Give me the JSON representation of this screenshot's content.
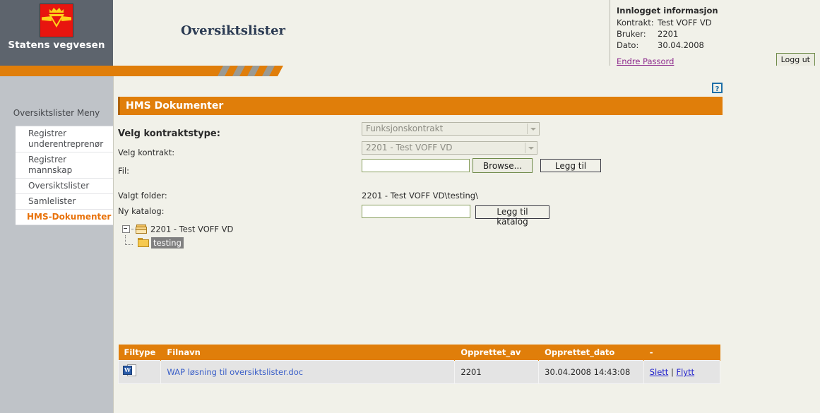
{
  "brand": {
    "name": "Statens vegvesen",
    "logo_icon": "vegvesen-emblem-icon"
  },
  "header": {
    "page_title": "Oversiktslister"
  },
  "login_info": {
    "heading": "Innlogget informasjon",
    "rows": [
      {
        "key": "Kontrakt:",
        "value": "Test VOFF VD"
      },
      {
        "key": "Bruker:",
        "value": "2201"
      },
      {
        "key": "Dato:",
        "value": "30.04.2008"
      }
    ],
    "change_password_link": "Endre Passord",
    "logout_label": "Logg ut"
  },
  "sidebar": {
    "menu_title": "Oversiktslister Meny",
    "items": [
      {
        "label": "Registrer underentreprenør",
        "active": false
      },
      {
        "label": "Registrer mannskap",
        "active": false
      },
      {
        "label": "Oversiktslister",
        "active": false
      },
      {
        "label": "Samlelister",
        "active": false
      },
      {
        "label": "HMS-Dokumenter",
        "active": true
      }
    ]
  },
  "main": {
    "help_icon_label": "?",
    "section_title": "HMS Dokumenter",
    "form": {
      "contract_type_label": "Velg kontraktstype:",
      "contract_type_value": "Funksjonskontrakt",
      "contract_label": "Velg kontrakt:",
      "contract_value": "2201 - Test VOFF VD",
      "file_label": "Fil:",
      "file_value": "",
      "file_placeholder": "",
      "browse_label": "Browse...",
      "add_label": "Legg til"
    },
    "folder": {
      "selected_folder_label": "Valgt folder:",
      "selected_folder_path": "2201 - Test VOFF VD\\testing\\",
      "new_catalog_label": "Ny katalog:",
      "new_catalog_value": "",
      "new_catalog_placeholder": "",
      "add_catalog_label": "Legg til katalog"
    },
    "tree": {
      "root_label": "2201 - Test VOFF VD",
      "child_label": "testing"
    },
    "table": {
      "columns": [
        "Filtype",
        "Filnavn",
        "Opprettet_av",
        "Opprettet_dato",
        "-"
      ],
      "rows": [
        {
          "filetype_icon": "word-document-icon",
          "filename": "WAP løsning til oversiktslister.doc",
          "created_by": "2201",
          "created_date": "30.04.2008 14:43:08",
          "delete_label": "Slett",
          "separator": "|",
          "move_label": "Flytt"
        }
      ]
    }
  },
  "colors": {
    "accent_orange": "#e07e0a",
    "header_gray": "#5d646d",
    "sidebar_gray": "#bfc3c8",
    "page_bg": "#f1f1e9",
    "link_purple": "#8d2a8d",
    "link_blue": "#2222cc",
    "active_menu": "#e8720a"
  }
}
